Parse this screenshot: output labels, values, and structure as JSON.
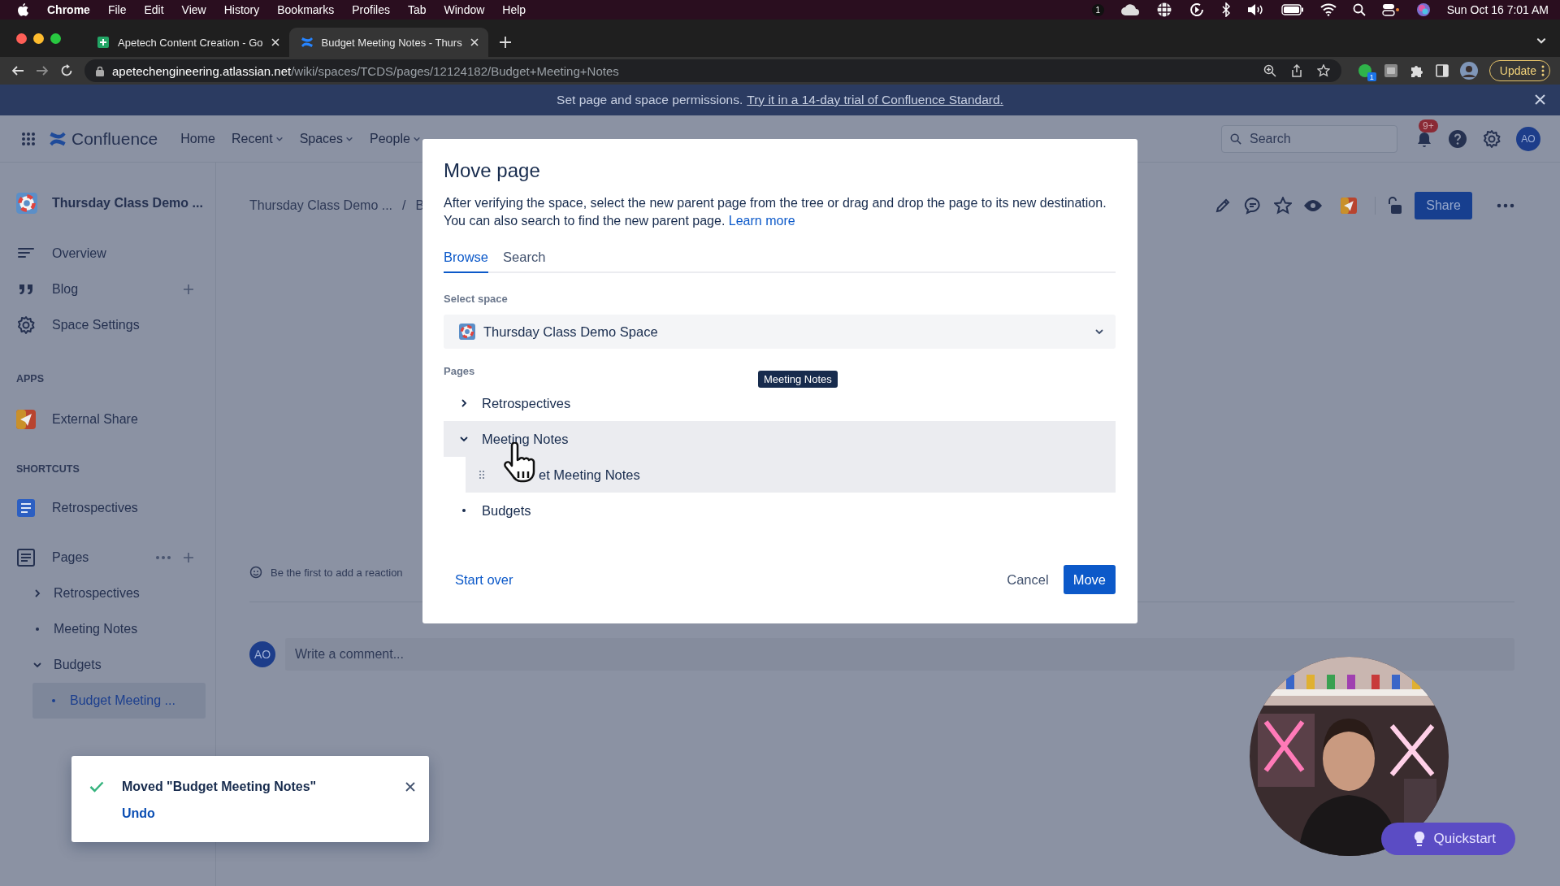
{
  "menu_bar": {
    "app": "Chrome",
    "items": [
      "File",
      "Edit",
      "View",
      "History",
      "Bookmarks",
      "Profiles",
      "Tab",
      "Window",
      "Help"
    ],
    "notification_count": "1",
    "clock": "Sun Oct 16  7:01 AM"
  },
  "browser": {
    "tabs": [
      {
        "title": "Apetech Content Creation - Go",
        "selected": false
      },
      {
        "title": "Budget Meeting Notes - Thurs",
        "selected": true
      }
    ],
    "url_host": "apetechengineering.atlassian.net",
    "url_path": "/wiki/spaces/TCDS/pages/12124182/Budget+Meeting+Notes",
    "extension_badge": "1",
    "update_button": "Update"
  },
  "banner": {
    "text": "Set page and space permissions.",
    "link": "Try it in a 14-day trial of Confluence Standard."
  },
  "top_nav": {
    "product": "Confluence",
    "items": [
      {
        "label": "Home",
        "dropdown": false
      },
      {
        "label": "Recent",
        "dropdown": true
      },
      {
        "label": "Spaces",
        "dropdown": true
      },
      {
        "label": "People",
        "dropdown": true
      }
    ],
    "search": {
      "placeholder": "Search"
    },
    "notification_badge": "9+",
    "avatar": "AO"
  },
  "sidebar": {
    "space_title": "Thursday Class Demo ...",
    "items": [
      {
        "label": "Overview",
        "add": false
      },
      {
        "label": "Blog",
        "add": true
      },
      {
        "label": "Space Settings",
        "add": false
      }
    ],
    "apps_heading": "APPS",
    "apps": [
      {
        "label": "External Share"
      }
    ],
    "shortcuts_heading": "SHORTCUTS",
    "shortcuts": [
      {
        "label": "Retrospectives"
      }
    ],
    "pages_label": "Pages",
    "pages": [
      {
        "label": "Retrospectives",
        "kind": "parent",
        "expanded": false,
        "selected": false
      },
      {
        "label": "Meeting Notes",
        "kind": "leaf",
        "selected": false
      },
      {
        "label": "Budgets",
        "kind": "parent",
        "expanded": true,
        "selected": false,
        "children": [
          {
            "label": "Budget Meeting ...",
            "kind": "leaf",
            "selected": true
          }
        ]
      }
    ]
  },
  "page": {
    "breadcrumbs": [
      "Thursday Class Demo ...",
      "B"
    ],
    "breadcrumb_separator": "/",
    "share_button": "Share",
    "reaction_prompt": "Be the first to add a reaction",
    "comment": {
      "avatar": "AO",
      "placeholder": "Write a comment..."
    }
  },
  "dialog": {
    "title": "Move page",
    "description": "After verifying the space, select the new parent page from the tree or drag and drop the page to its new destination. You can also search to find the new parent page.",
    "learn_more": "Learn more",
    "tabs": [
      {
        "label": "Browse",
        "selected": true
      },
      {
        "label": "Search",
        "selected": false
      }
    ],
    "space_label": "Select space",
    "space": "Thursday Class Demo Space",
    "pages_label": "Pages",
    "tree": [
      {
        "label": "Retrospectives",
        "kind": "parent",
        "expanded": false,
        "highlighted": false
      },
      {
        "label": "Meeting Notes",
        "kind": "parent",
        "expanded": true,
        "highlighted": true,
        "children": [
          {
            "label": "et Meeting Notes",
            "hovered": true
          }
        ]
      },
      {
        "label": "Budgets",
        "kind": "leaf",
        "highlighted": false
      }
    ],
    "drag_preview": "Meeting Notes",
    "start_over": "Start over",
    "cancel": "Cancel",
    "confirm": "Move"
  },
  "toast": {
    "message": "Moved \"Budget Meeting Notes\"",
    "action": "Undo"
  },
  "quickstart_button": "Quickstart"
}
